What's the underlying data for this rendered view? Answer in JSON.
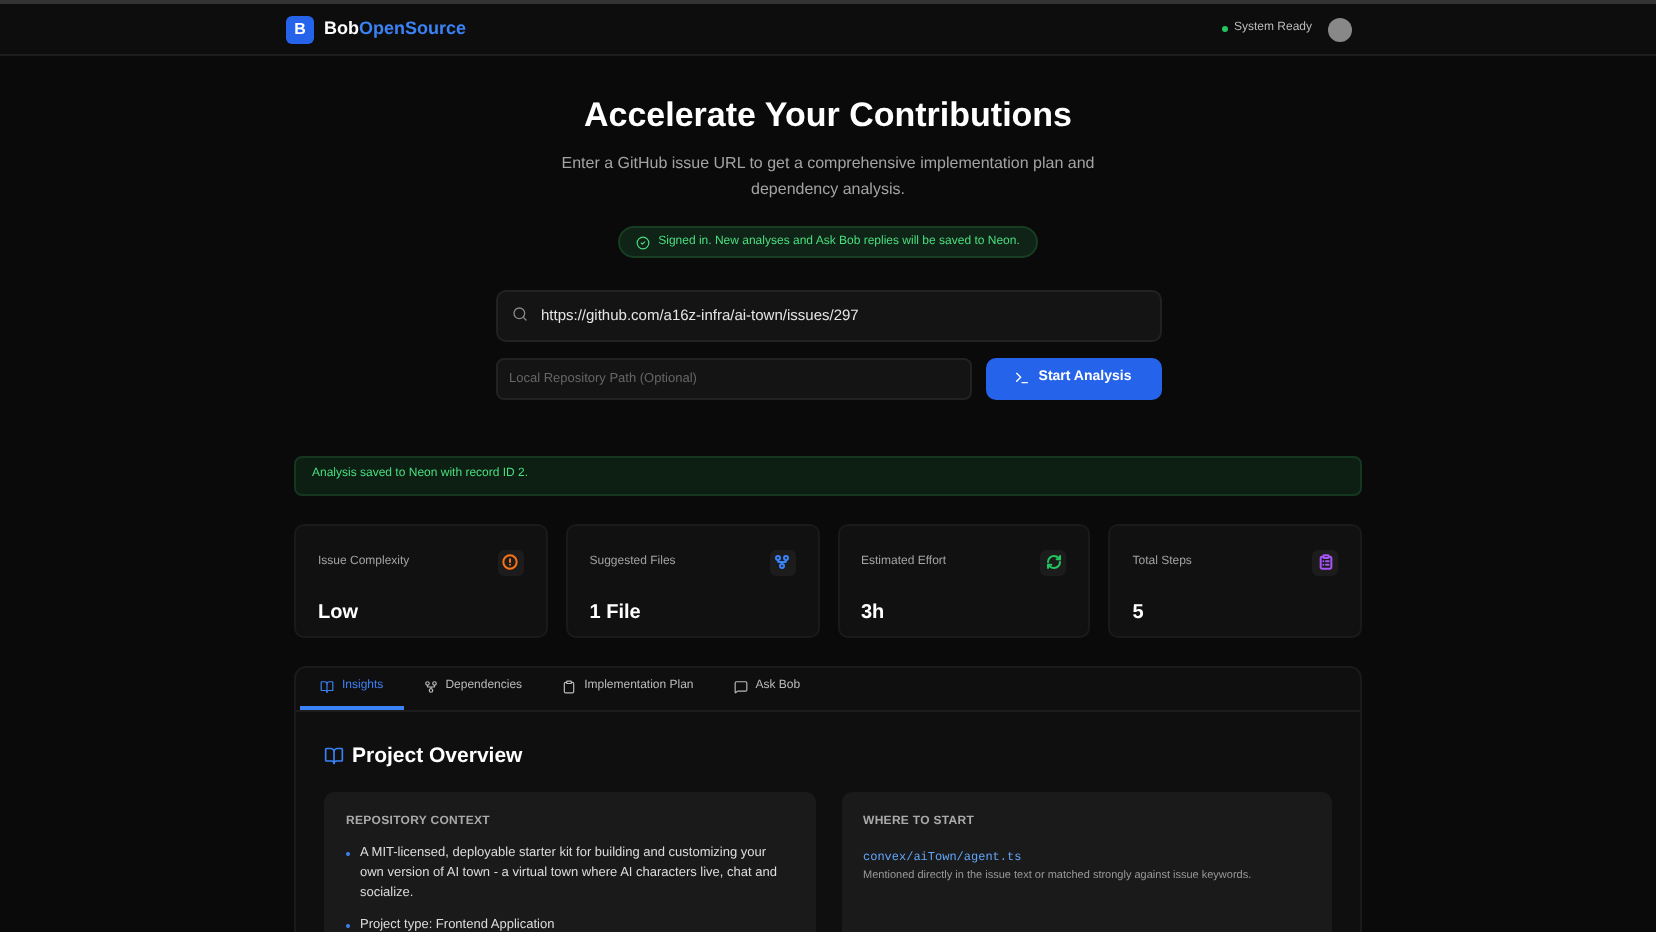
{
  "header": {
    "logo_letter": "B",
    "brand_primary": "Bob",
    "brand_accent": "OpenSource",
    "status": "System Ready"
  },
  "hero": {
    "title": "Accelerate Your Contributions",
    "subtitle": "Enter a GitHub issue URL to get a comprehensive implementation plan and dependency analysis.",
    "notice": "Signed in. New analyses and Ask Bob replies will be saved to Neon."
  },
  "form": {
    "issue_url": "https://github.com/a16z-infra/ai-town/issues/297",
    "repo_path_placeholder": "Local Repository Path (Optional)",
    "submit": "Start Analysis"
  },
  "banner": "Analysis saved to Neon with record ID 2.",
  "stats": [
    {
      "label": "Issue Complexity",
      "value": "Low",
      "kind": "alert",
      "color": "#f97316"
    },
    {
      "label": "Suggested Files",
      "value": "1 File",
      "kind": "branch",
      "color": "#3b82f6"
    },
    {
      "label": "Estimated Effort",
      "value": "3h",
      "kind": "refresh",
      "color": "#22c55e"
    },
    {
      "label": "Total Steps",
      "value": "5",
      "kind": "list",
      "color": "#a855f7"
    }
  ],
  "tabs": [
    {
      "label": "Insights",
      "kind": "book",
      "selected": true
    },
    {
      "label": "Dependencies",
      "kind": "branch",
      "selected": false
    },
    {
      "label": "Implementation Plan",
      "kind": "clipboard",
      "selected": false
    },
    {
      "label": "Ask Bob",
      "kind": "chat",
      "selected": false
    }
  ],
  "overview": {
    "title": "Project Overview",
    "repository_context": {
      "heading": "REPOSITORY CONTEXT",
      "bullets": [
        "A MIT-licensed, deployable starter kit for building and customizing your own version of AI town - a virtual town where AI characters live, chat and socialize.",
        "Project type: Frontend Application"
      ]
    },
    "where_to_start": {
      "heading": "WHERE TO START",
      "file": "convex/aiTown/agent.ts",
      "reason": "Mentioned directly in the issue text or matched strongly against issue keywords."
    }
  }
}
